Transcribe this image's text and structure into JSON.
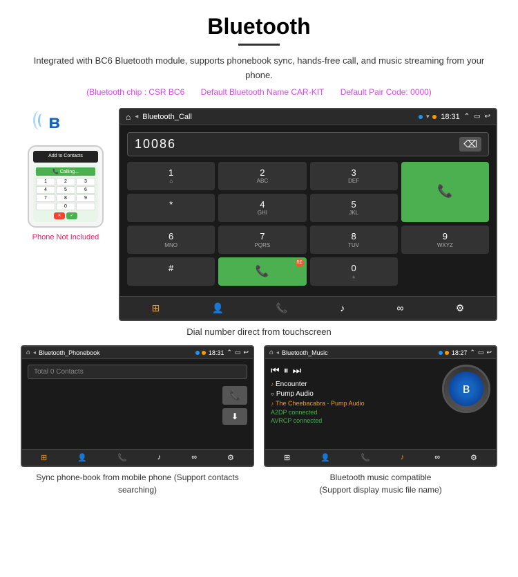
{
  "page": {
    "title": "Bluetooth",
    "description": "Integrated with BC6 Bluetooth module, supports phonebook sync, hands-free call, and music streaming from your phone.",
    "specs": [
      "(Bluetooth chip : CSR BC6",
      "Default Bluetooth Name CAR-KIT",
      "Default Pair Code: 0000)"
    ],
    "phone_not_included": "Phone Not Included",
    "dial_caption": "Dial number direct from touchscreen",
    "phonebook_caption": "Sync phone-book from mobile phone\n(Support contacts searching)",
    "music_caption": "Bluetooth music compatible\n(Support display music file name)"
  },
  "dial_screen": {
    "app_name": "Bluetooth_Call",
    "time": "18:31",
    "number": "10086",
    "keys": [
      {
        "label": "1",
        "sub": "⌂"
      },
      {
        "label": "2",
        "sub": "ABC"
      },
      {
        "label": "3",
        "sub": "DEF"
      },
      {
        "label": "*",
        "sub": ""
      },
      {
        "label": "4",
        "sub": "GHI"
      },
      {
        "label": "5",
        "sub": "JKL"
      },
      {
        "label": "6",
        "sub": "MNO"
      },
      {
        "label": "0",
        "sub": "+"
      },
      {
        "label": "7",
        "sub": "PQRS"
      },
      {
        "label": "8",
        "sub": "TUV"
      },
      {
        "label": "9",
        "sub": "WXYZ"
      },
      {
        "label": "#",
        "sub": ""
      }
    ]
  },
  "phonebook_screen": {
    "app_name": "Bluetooth_Phonebook",
    "time": "18:31",
    "contacts_placeholder": "Total 0 Contacts"
  },
  "music_screen": {
    "app_name": "Bluetooth_Music",
    "time": "18:27",
    "tracks": [
      {
        "icon": "♪",
        "name": "Encounter",
        "active": false
      },
      {
        "icon": "○",
        "name": "Pump Audio",
        "active": false
      },
      {
        "icon": "♪",
        "name": "The Cheebacabra - Pump Audio",
        "active": true
      }
    ],
    "connected1": "A2DP connected",
    "connected2": "AVRCP connected"
  },
  "bottom_bar_labels": [
    "⊞",
    "👤",
    "☎",
    "♪",
    "∞",
    "⚙"
  ],
  "small_bottom_bar_labels": [
    "⊞",
    "👤",
    "☎",
    "♪",
    "∞",
    "⚙"
  ]
}
